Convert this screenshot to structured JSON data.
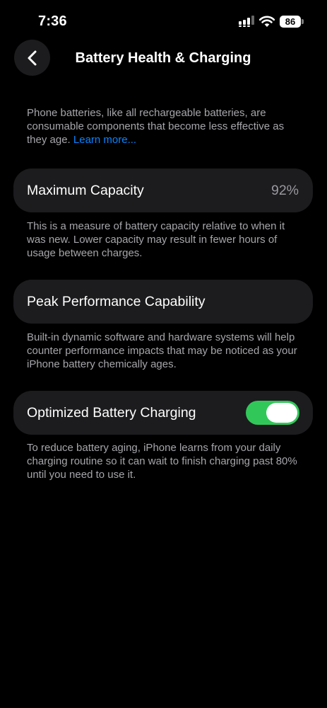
{
  "status_bar": {
    "time": "7:36",
    "battery_level": "86"
  },
  "header": {
    "title": "Battery Health & Charging"
  },
  "intro": {
    "text": "Phone batteries, like all rechargeable batteries, are consumable components that become less effective as they age.",
    "link": "Learn more..."
  },
  "maximum_capacity": {
    "label": "Maximum Capacity",
    "value": "92%",
    "footnote": "This is a measure of battery capacity relative to when it was new. Lower capacity may result in fewer hours of usage between charges."
  },
  "peak_performance": {
    "label": "Peak Performance Capability",
    "footnote": "Built-in dynamic software and hardware systems will help counter performance impacts that may be noticed as your iPhone battery chemically ages."
  },
  "optimized_charging": {
    "label": "Optimized Battery Charging",
    "enabled": true,
    "footnote": "To reduce battery aging, iPhone learns from your daily charging routine so it can wait to finish charging past 80% until you need to use it."
  },
  "colors": {
    "background": "#000000",
    "card": "#1c1c1e",
    "link": "#0a84ff",
    "toggle_on": "#31c859",
    "secondary_text": "#a6a6ab"
  }
}
